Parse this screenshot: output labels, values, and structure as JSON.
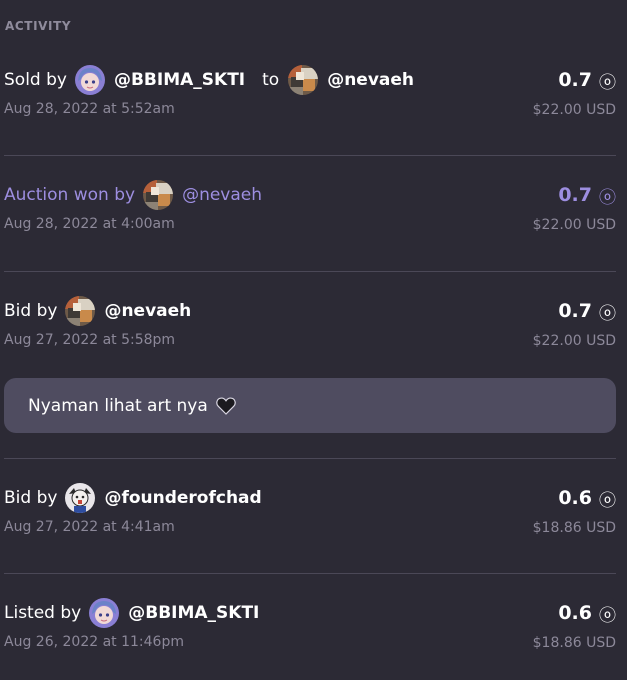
{
  "section_title": "ACTIVITY",
  "entries": [
    {
      "prefix": "Sold by",
      "user": "@BBIMA_SKTI",
      "avatar_style": "anime",
      "to_word": "to",
      "to_user": "@nevaeh",
      "to_avatar_style": "collage",
      "amount": "0.7",
      "date": "Aug 28, 2022 at 5:52am",
      "usd": "$22.00 USD"
    },
    {
      "prefix": "Auction won by",
      "user": "@nevaeh",
      "avatar_style": "collage",
      "amount": "0.7",
      "date": "Aug 28, 2022 at 4:00am",
      "usd": "$22.00 USD",
      "highlight_color": "#9d8ee0"
    },
    {
      "prefix": "Bid by",
      "user": "@nevaeh",
      "avatar_style": "collage",
      "amount": "0.7",
      "date": "Aug 27, 2022 at 5:58pm",
      "usd": "$22.00 USD",
      "comment": "Nyaman lihat art nya"
    },
    {
      "prefix": "Bid by",
      "user": "@founderofchad",
      "avatar_style": "cartoon",
      "amount": "0.6",
      "date": "Aug 27, 2022 at 4:41am",
      "usd": "$18.86 USD"
    },
    {
      "prefix": "Listed by",
      "user": "@BBIMA_SKTI",
      "avatar_style": "anime",
      "amount": "0.6",
      "date": "Aug 26, 2022 at 11:46pm",
      "usd": "$18.86 USD"
    }
  ],
  "currency_icon": "tezos-icon",
  "comment_icon": "black-heart-icon",
  "colors": {
    "background": "#2c2a35",
    "divider": "#4b4857",
    "muted_text": "#8c8899",
    "accent_purple": "#9d8ee0",
    "comment_bubble": "#4f4c60"
  }
}
